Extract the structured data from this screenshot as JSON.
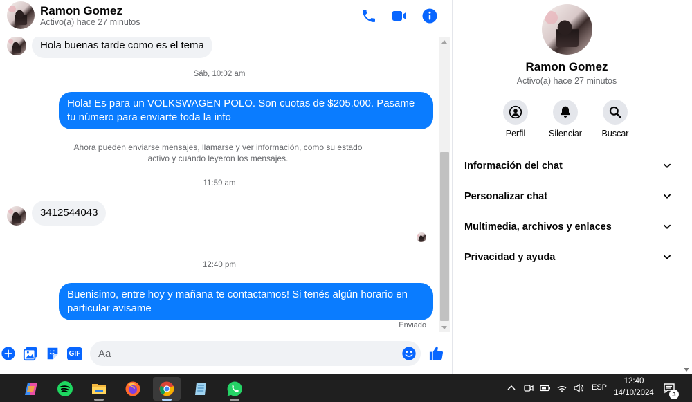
{
  "colors": {
    "accent": "#0a7cff",
    "icon_blue": "#0866ff",
    "bubble_in": "#f0f2f5",
    "secondary_text": "#65676b",
    "taskbar": "#1f1f1f"
  },
  "header": {
    "name": "Ramon Gomez",
    "status": "Activo(a) hace 27 minutos",
    "icons": [
      "phone-icon",
      "video-camera-icon",
      "info-icon"
    ]
  },
  "messages": [
    {
      "type": "incoming",
      "text": "Hola buenas tarde como es el tema"
    },
    {
      "type": "timestamp",
      "text": "Sáb, 10:02 am"
    },
    {
      "type": "outgoing",
      "text": "Hola! Es para un VOLKSWAGEN POLO. Son cuotas de $205.000. Pasame tu número para enviarte toda la info"
    },
    {
      "type": "system",
      "text": "Ahora pueden enviarse mensajes, llamarse y ver información, como su estado activo y cuándo leyeron los mensajes."
    },
    {
      "type": "timestamp",
      "text": "11:59 am"
    },
    {
      "type": "incoming",
      "text": "3412544043"
    },
    {
      "type": "timestamp",
      "text": "12:40 pm"
    },
    {
      "type": "outgoing",
      "text": "Buenisimo, entre hoy y mañana te contactamos! Si tenés algún horario en particular avisame"
    }
  ],
  "sent_status": "Enviado",
  "composer": {
    "placeholder": "Aa",
    "gif_label": "GIF",
    "icons": [
      "plus-icon",
      "image-icon",
      "sticker-icon",
      "gif-icon",
      "emoji-icon",
      "like-icon"
    ]
  },
  "panel": {
    "name": "Ramon Gomez",
    "status": "Activo(a) hace 27 minutos",
    "actions": [
      {
        "label": "Perfil",
        "icon": "profile-icon"
      },
      {
        "label": "Silenciar",
        "icon": "bell-icon"
      },
      {
        "label": "Buscar",
        "icon": "search-icon"
      }
    ],
    "sections": [
      {
        "label": "Información del chat"
      },
      {
        "label": "Personalizar chat"
      },
      {
        "label": "Multimedia, archivos y enlaces"
      },
      {
        "label": "Privacidad y ayuda"
      }
    ]
  },
  "taskbar": {
    "apps": [
      "copilot-icon",
      "spotify-icon",
      "file-explorer-icon",
      "firefox-icon",
      "chrome-icon",
      "notepad-icon",
      "whatsapp-icon"
    ],
    "language": "ESP",
    "time": "12:40",
    "date": "14/10/2024",
    "notifications": "3"
  }
}
